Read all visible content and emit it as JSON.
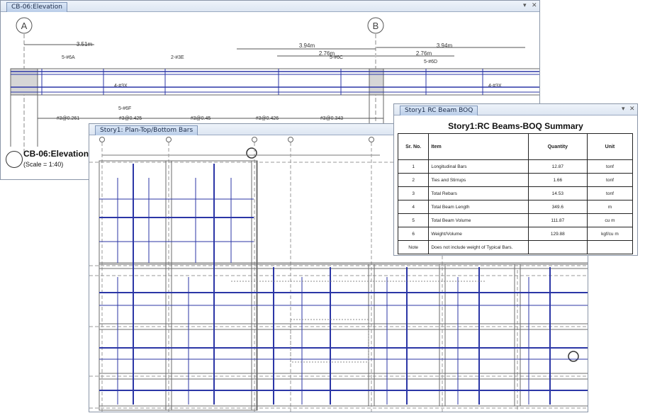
{
  "elevation_window": {
    "tab_title": "CB-06:Elevation",
    "controls": {
      "dropdown": "▾",
      "close": "✕"
    },
    "grid_labels": [
      "A",
      "B"
    ],
    "dimensions": [
      "3.51m",
      "3.94m",
      "2.76m",
      "2.76m",
      "3.94m"
    ],
    "bar_marks": [
      "5-#6A",
      "2-#3E",
      "5-#6C",
      "5-#6D",
      "4-#3X",
      "4-#3X",
      "5-#6F"
    ],
    "stirrup_labels": [
      "#3@0.261",
      "#3@0.425",
      "#3@0.45",
      "#3@0.426",
      "#3@0.343"
    ],
    "title": "CB-06:Elevation",
    "scale": "(Scale = 1:40)"
  },
  "plan_window": {
    "tab_title": "Story1: Plan-Top/Bottom Bars",
    "controls": {
      "dropdown": "▾",
      "close": "✕"
    }
  },
  "boq_window": {
    "tab_title": "Story1 RC Beam BOQ",
    "controls": {
      "dropdown": "▾",
      "close": "✕"
    },
    "title": "Story1:RC Beams-BOQ Summary",
    "headers": {
      "sr": "Sr. No.",
      "item": "Item",
      "quantity": "Quantity",
      "unit": "Unit"
    },
    "rows": [
      {
        "sr": "1",
        "item": "Longitudinal Bars",
        "quantity": "12.87",
        "unit": "tonf"
      },
      {
        "sr": "2",
        "item": "Ties and Stirrups",
        "quantity": "1.66",
        "unit": "tonf"
      },
      {
        "sr": "3",
        "item": "Total Rebars",
        "quantity": "14.53",
        "unit": "tonf"
      },
      {
        "sr": "4",
        "item": "Total Beam Length",
        "quantity": "349.6",
        "unit": "m"
      },
      {
        "sr": "5",
        "item": "Total Beam Volume",
        "quantity": "111.87",
        "unit": "cu m"
      },
      {
        "sr": "6",
        "item": "Weight/Volume",
        "quantity": "129.88",
        "unit": "kgf/cu m"
      },
      {
        "sr": "Note",
        "item": "Does not include weight of Typical Bars.",
        "quantity": "",
        "unit": ""
      }
    ]
  },
  "colors": {
    "rebar_blue": "#2b36a6",
    "tab_blue": "#c6d7ee",
    "line_gray": "#6b6b6b"
  }
}
